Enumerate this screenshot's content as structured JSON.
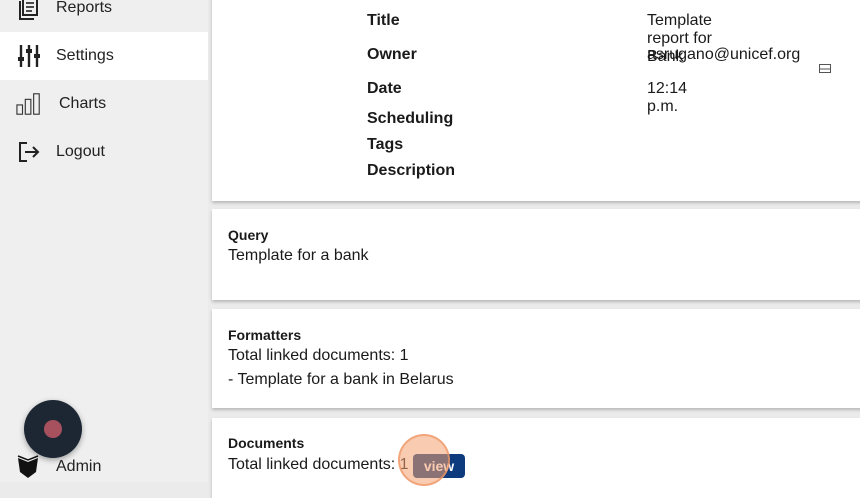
{
  "sidebar": {
    "items": [
      {
        "label": "Reports",
        "icon": "reports-icon",
        "active": false
      },
      {
        "label": "Settings",
        "icon": "settings-sliders-icon",
        "active": true
      },
      {
        "label": "Charts",
        "icon": "bar-chart-icon",
        "active": false
      },
      {
        "label": "Logout",
        "icon": "logout-icon",
        "active": false
      }
    ],
    "admin_label": "Admin"
  },
  "details": {
    "title_label": "Title",
    "title_value": "Template report for Bank",
    "owner_label": "Owner",
    "owner_value": "asrugano@unicef.org",
    "date_label": "Date",
    "date_value": "12:14 p.m.",
    "scheduling_label": "Scheduling",
    "tags_label": "Tags",
    "description_label": "Description"
  },
  "query": {
    "title": "Query",
    "text": "Template for a bank"
  },
  "formatters": {
    "title": "Formatters",
    "count_text": "Total linked documents: 1",
    "item_text": "- Template for a bank in Belarus"
  },
  "documents": {
    "title": "Documents",
    "count_text": "Total linked documents: 1",
    "view_label": "view"
  },
  "colors": {
    "view_button": "#0d3b7d",
    "fab": "#1d2733",
    "fab_dot": "#a8515e",
    "click_halo": "#f4a070"
  }
}
